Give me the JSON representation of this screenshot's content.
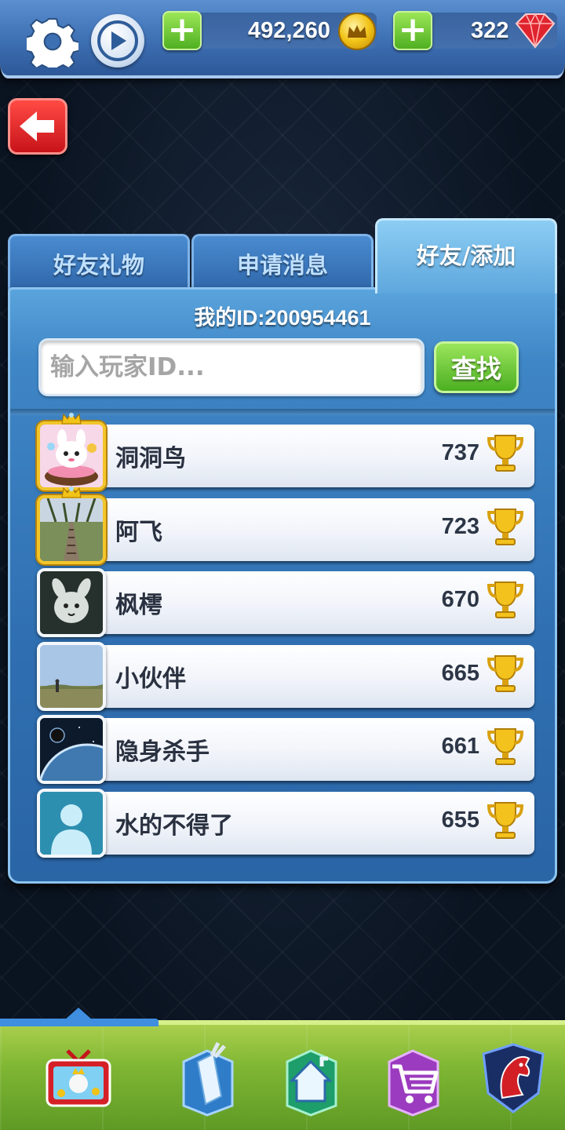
{
  "header": {
    "coins": "492,260",
    "gems": "322",
    "plus": "+"
  },
  "tabs": [
    {
      "label": "好友礼物"
    },
    {
      "label": "申请消息"
    },
    {
      "label": "好友/添加"
    }
  ],
  "panel": {
    "my_id": "我的ID:200954461",
    "search_placeholder": "输入玩家ID...",
    "find_label": "查找"
  },
  "friends": [
    {
      "name": "洞洞鸟",
      "score": "737",
      "avatar": "cartoon-rabbit",
      "frame": "gold"
    },
    {
      "name": "阿飞",
      "score": "723",
      "avatar": "railway-photo",
      "frame": "gold"
    },
    {
      "name": "枫樗",
      "score": "670",
      "avatar": "white-toy-photo",
      "frame": "plain"
    },
    {
      "name": "小伙伴",
      "score": "665",
      "avatar": "landscape-photo",
      "frame": "plain"
    },
    {
      "name": "隐身杀手",
      "score": "661",
      "avatar": "planet-photo",
      "frame": "plain"
    },
    {
      "name": "水的不得了",
      "score": "655",
      "avatar": "default-silhouette",
      "frame": "plain"
    }
  ],
  "bottom_nav": [
    {
      "icon": "tv-icon",
      "active": true
    },
    {
      "icon": "golf-bag-icon",
      "active": false
    },
    {
      "icon": "home-icon",
      "active": false
    },
    {
      "icon": "shop-cart-icon",
      "active": false
    },
    {
      "icon": "horse-emblem-icon",
      "active": false
    }
  ],
  "colors": {
    "accent_blue": "#3f86c6",
    "button_green": "#4caf22",
    "back_red": "#c8141a",
    "gold": "#f2c318"
  }
}
